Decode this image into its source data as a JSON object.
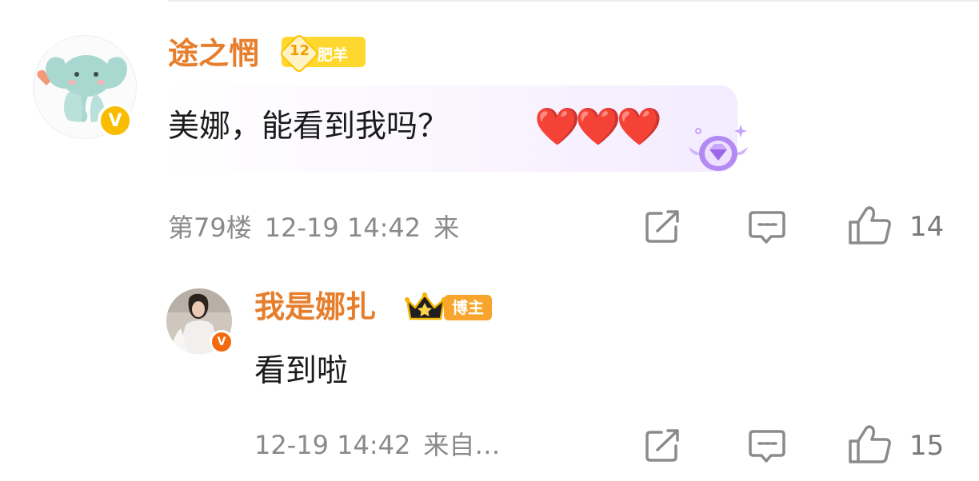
{
  "thread": {
    "comment": {
      "author": "途之惘",
      "level_number": "12",
      "level_tag": "肥羊",
      "verified_badge": "V",
      "text": "美娜，能看到我吗？",
      "emoji": "❤️❤️❤️",
      "floor": "第79楼",
      "time": "12-19 14:42",
      "source": "来",
      "likes": "14"
    },
    "reply": {
      "author": "我是娜扎",
      "author_tag": "博主",
      "verified_badge": "V",
      "text": "看到啦",
      "time": "12-19 14:42",
      "source": "来自…",
      "likes": "15"
    }
  },
  "colors": {
    "username": "#e77e2c",
    "meta": "#8a8a8a",
    "verified": "#f8bd00",
    "level_badge": "#ffd82f",
    "blogger_tag": "#f8a52d"
  },
  "icons": [
    "share-icon",
    "comment-icon",
    "like-icon",
    "elephant-avatar",
    "vip-gem-icon",
    "crown-icon"
  ]
}
